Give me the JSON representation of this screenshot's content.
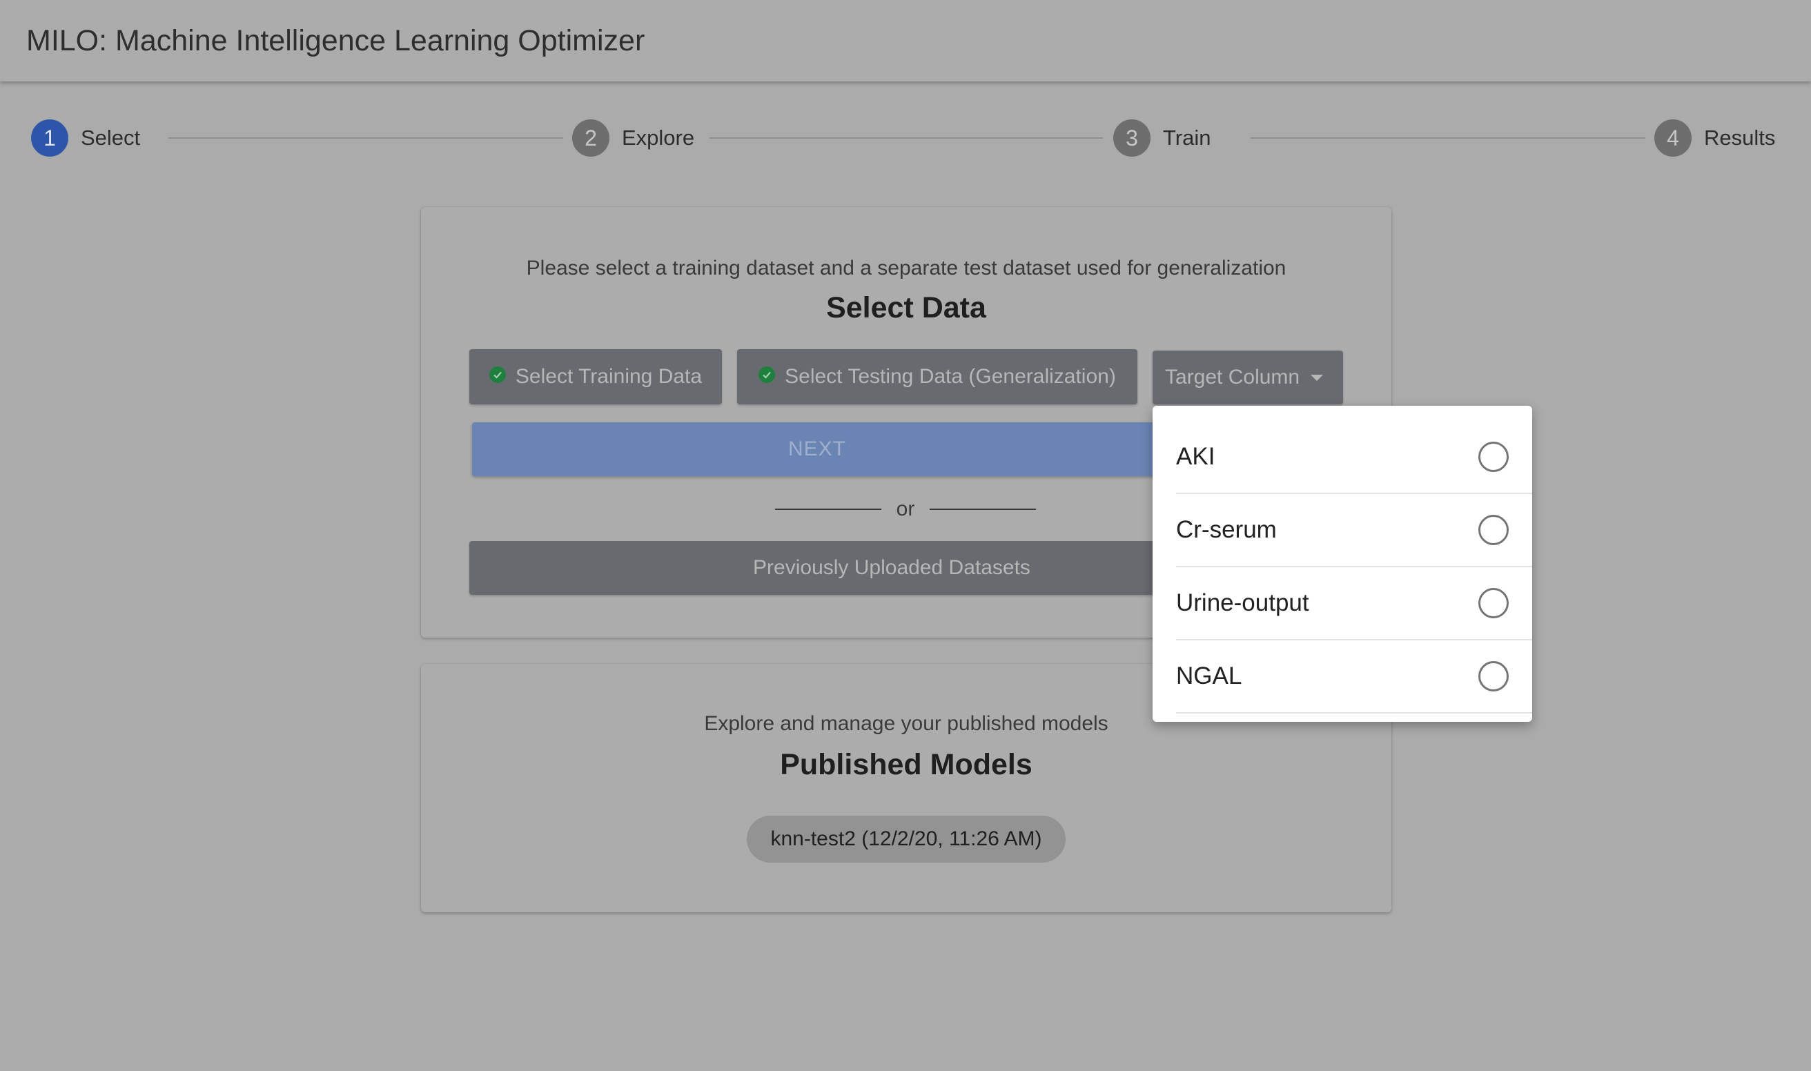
{
  "app": {
    "title": "MILO: Machine Intelligence Learning Optimizer"
  },
  "stepper": {
    "steps": [
      {
        "number": "1",
        "label": "Select",
        "active": true
      },
      {
        "number": "2",
        "label": "Explore",
        "active": false
      },
      {
        "number": "3",
        "label": "Train",
        "active": false
      },
      {
        "number": "4",
        "label": "Results",
        "active": false
      }
    ]
  },
  "select_card": {
    "subtitle": "Please select a training dataset and a separate test dataset used for generalization",
    "title": "Select Data",
    "training_button": "Select Training Data",
    "testing_button": "Select Testing Data (Generalization)",
    "target_column_label": "Target Column",
    "next_button": "NEXT",
    "or_text": "or",
    "previous_button": "Previously Uploaded Datasets"
  },
  "models_card": {
    "subtitle": "Explore and manage your published models",
    "title": "Published Models",
    "models": [
      {
        "label": "knn-test2 (12/2/20, 11:26 AM)"
      }
    ]
  },
  "target_menu": {
    "options": [
      {
        "label": "AKI",
        "selected": false
      },
      {
        "label": "Cr-serum",
        "selected": false
      },
      {
        "label": "Urine-output",
        "selected": false
      },
      {
        "label": "NGAL",
        "selected": false
      }
    ]
  },
  "colors": {
    "active_step": "#2d55a9",
    "check": "#1e7f3e",
    "next_button": "#6a84b4"
  }
}
